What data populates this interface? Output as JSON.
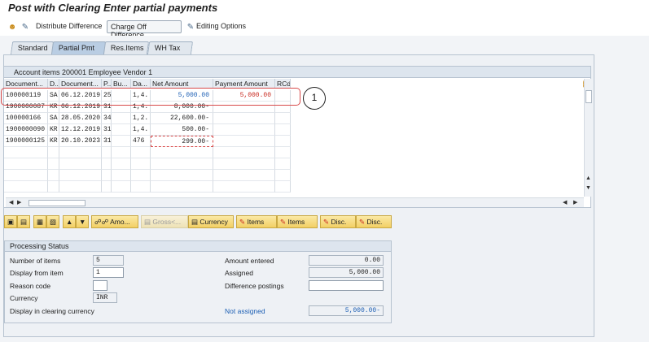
{
  "title": "Post with Clearing Enter partial payments",
  "toolbar": {
    "distribute": "Distribute Difference",
    "charge_off": "Charge Off Difference",
    "editing": "Editing Options"
  },
  "tabs": [
    "Standard",
    "Partial Pmt",
    "Res.Items",
    "WH Tax"
  ],
  "table": {
    "title": "Account items 200001 Employee Vendor 1",
    "headers": [
      "Document...",
      "D...",
      "Document...",
      "P...",
      "Bu...",
      "Da...",
      "Net Amount",
      "Payment Amount",
      "RCd"
    ],
    "rows": [
      [
        "100000119",
        "SA",
        "06.12.2019",
        "25",
        "",
        "1,4..",
        "5,000.00",
        "5,000.00",
        ""
      ],
      [
        "1900000087",
        "KR",
        "06.12.2019",
        "31",
        "",
        "1,4..",
        "8,000.00-",
        "",
        ""
      ],
      [
        "100000166",
        "SA",
        "28.05.2020",
        "34",
        "",
        "1,2..",
        "22,600.00-",
        "",
        ""
      ],
      [
        "1900000090",
        "KR",
        "12.12.2019",
        "31",
        "",
        "1,4..",
        "500.00-",
        "",
        ""
      ],
      [
        "1900000125",
        "KR",
        "20.10.2023",
        "31",
        "",
        "476",
        "299.00-",
        "",
        ""
      ]
    ]
  },
  "callout": "1",
  "actions": {
    "amount": "Amo...",
    "gross": "Gross<...",
    "currency": "Currency",
    "items1": "Items",
    "items2": "Items",
    "disc1": "Disc.",
    "disc2": "Disc."
  },
  "processing": {
    "title": "Processing Status",
    "number_of_items_label": "Number of items",
    "number_of_items": "5",
    "display_from_label": "Display from item",
    "display_from": "1",
    "reason_code_label": "Reason code",
    "reason_code": "",
    "currency_label": "Currency",
    "currency": "INR",
    "display_clearing_label": "Display in clearing currency",
    "amount_entered_label": "Amount entered",
    "amount_entered": "0.00",
    "assigned_label": "Assigned",
    "assigned": "5,000.00",
    "difference_label": "Difference postings",
    "difference": "",
    "not_assigned_label": "Not assigned",
    "not_assigned": "5,000.00-"
  },
  "colors": {
    "accent_blue": "#1d5fb4",
    "highlight_red": "#d84a4a",
    "button_gold": "#f2cf64"
  }
}
